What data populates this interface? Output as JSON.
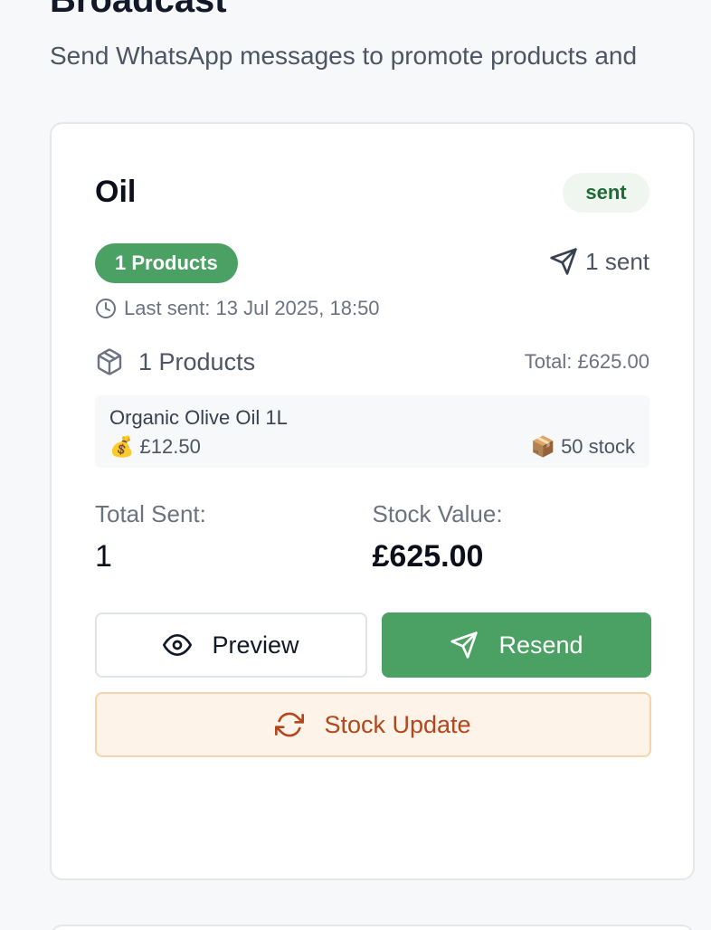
{
  "header": {
    "title": "Broadcast",
    "subtitle": "Send WhatsApp messages to promote products and"
  },
  "broadcast_card": {
    "title": "Oil",
    "status": "sent",
    "products_pill": "1 Products",
    "sent_count": "1 sent",
    "last_sent": "Last sent: 13 Jul 2025, 18:50",
    "products_label": "1 Products",
    "total": "Total: £625.00",
    "product": {
      "name": "Organic Olive Oil 1L",
      "price_emoji": "💰",
      "price": "£12.50",
      "stock_emoji": "📦",
      "stock": "50 stock"
    },
    "stats": {
      "total_sent_label": "Total Sent:",
      "total_sent_value": "1",
      "stock_value_label": "Stock Value:",
      "stock_value_value": "£625.00"
    },
    "buttons": {
      "preview": "Preview",
      "resend": "Resend",
      "stock_update": "Stock Update"
    }
  },
  "icons": {
    "send": "send-icon",
    "clock": "clock-icon",
    "package": "package-icon",
    "eye": "eye-icon",
    "refresh": "refresh-icon"
  },
  "colors": {
    "accent_green": "#4ba064",
    "badge_bg": "#eef6ef",
    "stock_bg": "#fef3e8",
    "stock_text": "#b4461b"
  }
}
